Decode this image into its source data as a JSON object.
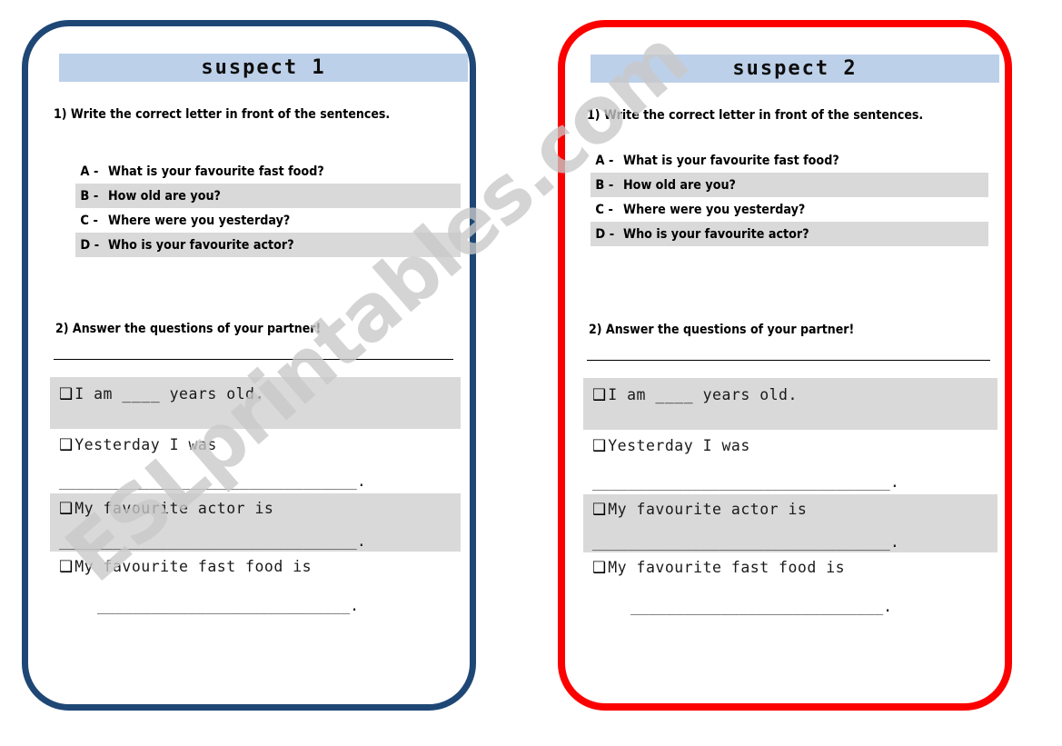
{
  "document": {
    "type": "worksheet",
    "watermark": "ESLprintables.com",
    "colors": {
      "card_left_border": "#1f4775",
      "card_right_border": "#fc0000",
      "title_bar": "#bdd0e9",
      "shading": "#d9d9d9",
      "text": "#000000"
    }
  },
  "cards": [
    {
      "id": "suspect-1",
      "title": "suspect 1",
      "border_color": "#1f4775",
      "instruction_1": "1)  Write the correct letter in front of the sentences.",
      "instruction_2": "2)  Answer the questions of your partner!",
      "questions": [
        {
          "letter": "A -",
          "text": "What is your favourite fast food?",
          "shaded": false
        },
        {
          "letter": "B -",
          "text": "How old are you?",
          "shaded": true
        },
        {
          "letter": "C -",
          "text": "Where were you yesterday?",
          "shaded": false
        },
        {
          "letter": "D -",
          "text": "Who is your favourite actor?",
          "shaded": true
        }
      ],
      "answers": [
        {
          "checkbox": "❑",
          "text": "I am ____ years old.",
          "shaded": true,
          "blank": ""
        },
        {
          "checkbox": "❑",
          "text": "Yesterday I was",
          "shaded": false,
          "blank": "_________________________________."
        },
        {
          "checkbox": "❑",
          "text": "My favourite actor is",
          "shaded": true,
          "blank": "_________________________________."
        },
        {
          "checkbox": "❑",
          "text": "My favourite fast food is",
          "shaded": false,
          "blank": "____________________________."
        }
      ]
    },
    {
      "id": "suspect-2",
      "title": "suspect 2",
      "border_color": "#fc0000",
      "instruction_1": "1)  Write the correct letter in front of the sentences.",
      "instruction_2": "2)  Answer the questions of your partner!",
      "questions": [
        {
          "letter": "A -",
          "text": "What is your favourite fast food?",
          "shaded": false
        },
        {
          "letter": "B -",
          "text": "How old are you?",
          "shaded": true
        },
        {
          "letter": "C -",
          "text": "Where were you yesterday?",
          "shaded": false
        },
        {
          "letter": "D -",
          "text": "Who is your favourite actor?",
          "shaded": true
        }
      ],
      "answers": [
        {
          "checkbox": "❑",
          "text": "I am ____ years old.",
          "shaded": true,
          "blank": ""
        },
        {
          "checkbox": "❑",
          "text": "Yesterday I was",
          "shaded": false,
          "blank": "_________________________________."
        },
        {
          "checkbox": "❑",
          "text": "My favourite actor is",
          "shaded": true,
          "blank": "_________________________________."
        },
        {
          "checkbox": "❑",
          "text": "My favourite fast food is",
          "shaded": false,
          "blank": "____________________________."
        }
      ]
    }
  ]
}
